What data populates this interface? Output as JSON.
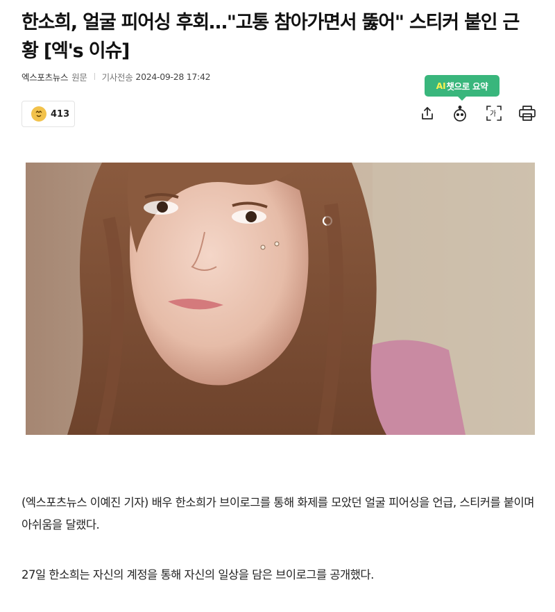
{
  "article": {
    "title": "한소희, 얼굴 피어싱 후회…\"고통 참아가면서 뚫어\" 스티커 붙인 근황 [엑's 이슈]",
    "source": "엑스포츠뉴스",
    "original_label": "원문",
    "date_label": "기사전송",
    "date": "2024-09-28 17:42"
  },
  "reaction": {
    "count": "413",
    "icon": "reaction-face-icon"
  },
  "toolbar": {
    "ai_summary_label_ai": "AI",
    "ai_summary_label_rest": "챗으로 요약",
    "icons": [
      "share-icon",
      "ai-bot-icon",
      "font-size-icon",
      "print-icon"
    ]
  },
  "body": {
    "paragraphs": [
      "(엑스포츠뉴스 이예진 기자) 배우 한소희가 브이로그를 통해 화제를 모았던 얼굴 피어싱을 언급, 스티커를 붙이며 아쉬움을 달랬다.",
      "27일 한소희는 자신의 계정을 통해 자신의 일상을 담은 브이로그를 공개했다."
    ]
  },
  "colors": {
    "ai_badge": "#39b67c",
    "ai_highlight": "#fff34f",
    "reaction_icon": "#f2c24b"
  }
}
